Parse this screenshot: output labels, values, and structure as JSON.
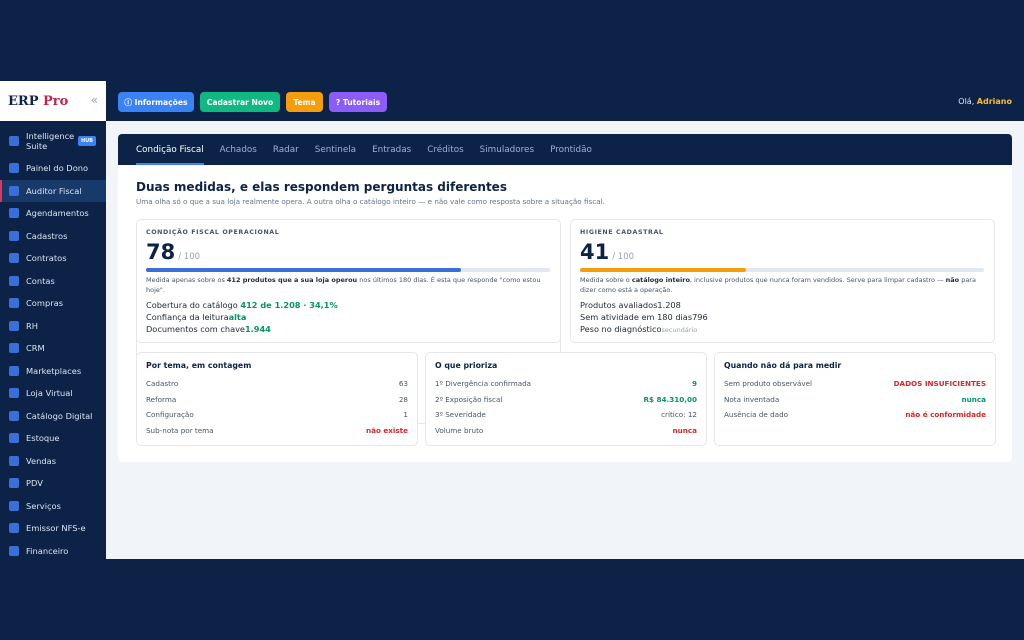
{
  "sidebar": {
    "logo_main": "ERP",
    "logo_pro": "Pro",
    "collapse_icon": "«",
    "hub_badge": "HUB",
    "items": [
      {
        "label": "Intelligence Suite"
      },
      {
        "label": "Painel do Dono"
      },
      {
        "label": "Auditor Fiscal"
      },
      {
        "label": "Agendamentos"
      },
      {
        "label": "Cadastros"
      },
      {
        "label": "Contratos"
      },
      {
        "label": "Contas"
      },
      {
        "label": "Compras"
      },
      {
        "label": "RH"
      },
      {
        "label": "CRM"
      },
      {
        "label": "Marketplaces"
      },
      {
        "label": "Loja Virtual"
      },
      {
        "label": "Catálogo Digital"
      },
      {
        "label": "Estoque"
      },
      {
        "label": "Vendas"
      },
      {
        "label": "PDV"
      },
      {
        "label": "Serviços"
      },
      {
        "label": "Emissor NFS-e"
      },
      {
        "label": "Financeiro"
      }
    ]
  },
  "topbar": {
    "buttons": [
      {
        "label": "ⓘ Informações",
        "color": "#3b82f6"
      },
      {
        "label": "Cadastrar Novo",
        "color": "#10b981"
      },
      {
        "label": "Tema",
        "color": "#f59e0b"
      },
      {
        "label": "? Tutoriais",
        "color": "#8b5cf6"
      }
    ],
    "greeting": "Olá,",
    "user": "Adriano"
  },
  "tabs": [
    "Condição Fiscal",
    "Achados",
    "Radar",
    "Sentinela",
    "Entradas",
    "Créditos",
    "Simuladores",
    "Prontidão"
  ],
  "section": {
    "title": "Duas medidas, e elas respondem perguntas diferentes",
    "subtitle": "Uma olha só o que a sua loja realmente opera. A outra olha o catálogo inteiro — e não vale como resposta sobre a situação fiscal."
  },
  "left_panel": {
    "label": "CONDIÇÃO FISCAL OPERACIONAL",
    "score": "78",
    "max": "/ 100",
    "progress": 0.78,
    "bar_color": "#3b6fd8",
    "desc_a": "Medida apenas sobre os ",
    "desc_b": "412 produtos que a sua loja operou",
    "desc_c": " nos últimos 180 dias. É esta que responde \"como estou hoje\".",
    "m1_label": "Cobertura do catálogo ",
    "m1_value": "412 de 1.208 · 34,1%",
    "m2_label": "Confiança da leitura",
    "m2_value": "alta",
    "m3_label": "Documentos com chave",
    "m3_value": "1.944"
  },
  "right_panel": {
    "label": "HIGIENE CADASTRAL",
    "score": "41",
    "max": "/ 100",
    "progress": 0.41,
    "bar_color": "#f59e0b",
    "desc_a": "Medida sobre o ",
    "desc_b": "catálogo inteiro",
    "desc_c": ", inclusive produtos que nunca foram vendidos. Serve para limpar cadastro — ",
    "desc_d": "não",
    "desc_e": " para dizer como está a operação.",
    "m1_label": "Produtos avaliados",
    "m1_value": "1.208",
    "m2_label": "Sem atividade em 180 dias",
    "m2_value": "796",
    "m3_label": "Peso no diagnóstico",
    "m3_value": "secundário"
  },
  "tema": {
    "title": "Por tema, em contagem",
    "rows": [
      {
        "label": "Cadastro",
        "value": "63"
      },
      {
        "label": "Reforma",
        "value": "28"
      },
      {
        "label": "Configuração",
        "value": "1"
      },
      {
        "label": "Sub-nota por tema",
        "value": "não existe"
      }
    ]
  },
  "prioriza": {
    "title": "O que prioriza",
    "rows": [
      {
        "label": "1º Divergência confirmada",
        "value": "9"
      },
      {
        "label": "2º Exposição fiscal",
        "value": "R$ 84.310,00"
      },
      {
        "label": "3º Severidade",
        "value": "crítico: 12"
      },
      {
        "label": "Volume bruto",
        "value": "nunca"
      }
    ]
  },
  "medir": {
    "title": "Quando não dá para medir",
    "rows": [
      {
        "label": "Sem produto observável",
        "value": "DADOS INSUFICIENTES"
      },
      {
        "label": "Nota inventada",
        "value": "nunca"
      },
      {
        "label": "Ausência de dado",
        "value": "não é conformidade"
      }
    ]
  }
}
